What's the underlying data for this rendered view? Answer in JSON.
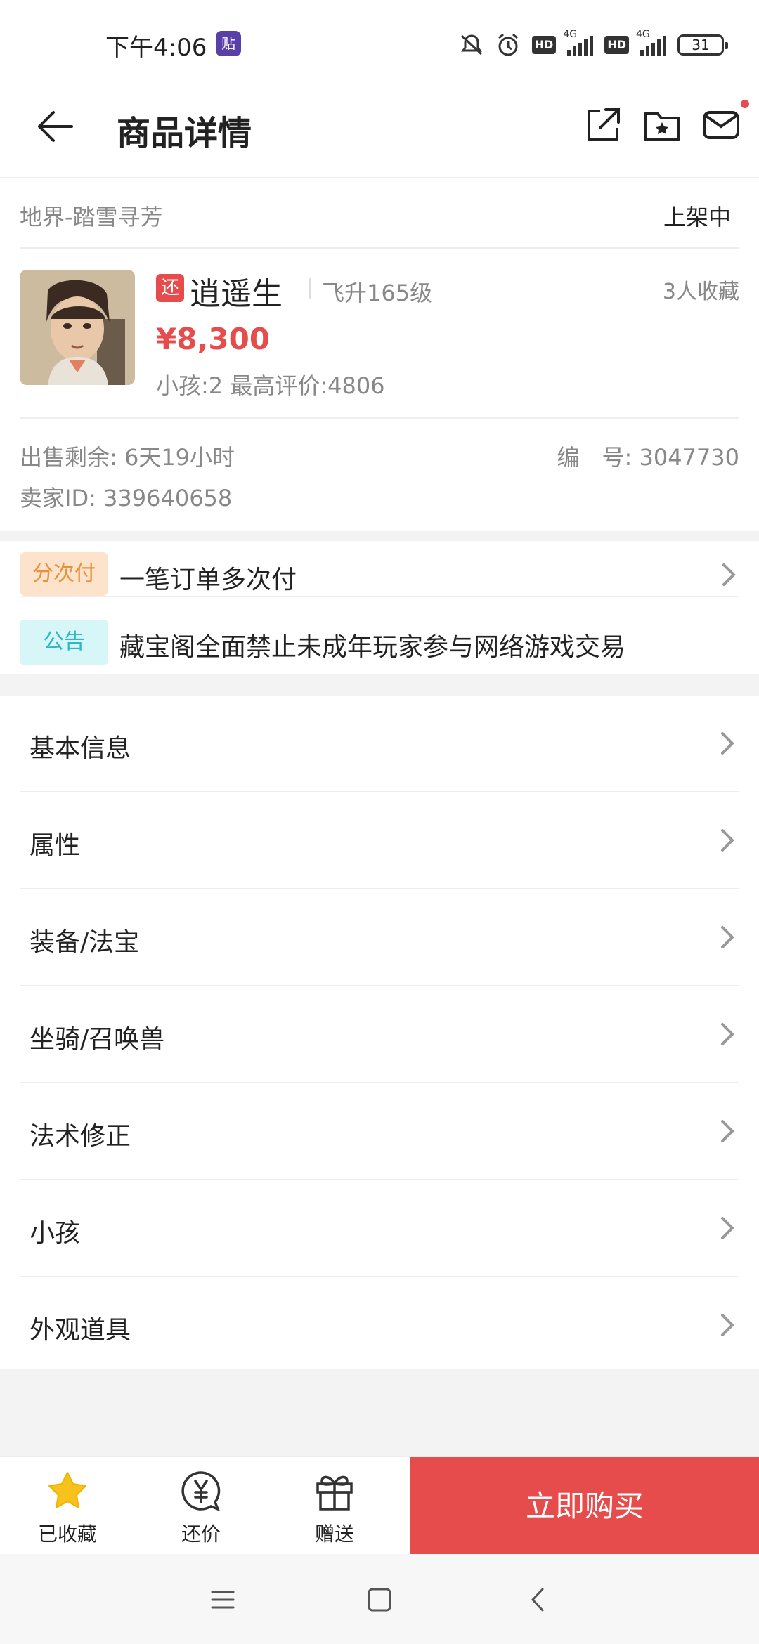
{
  "status_bar": {
    "time": "下午4:06",
    "app_badge": "贴",
    "battery": "31",
    "signal_1_label": "4G",
    "signal_2_label": "4G",
    "hd_1": "HD",
    "hd_2": "HD"
  },
  "header": {
    "title": "商品详情"
  },
  "server": {
    "name": "地界-踏雪寻芳",
    "status": "上架中"
  },
  "product": {
    "badge": "还",
    "name": "逍遥生",
    "level": "飞升165级",
    "favorites": "3人收藏",
    "price": "¥8,300",
    "kids_eval": "小孩:2 最高评价:4806"
  },
  "meta": {
    "sell_time": "出售剩余: 6天19小时",
    "serial": "编　号: 3047730",
    "seller": "卖家ID: 339640658"
  },
  "promo": {
    "installment_tag": "分次付",
    "installment_text": "一笔订单多次付",
    "notice_tag": "公告",
    "notice_text": "藏宝阁全面禁止未成年玩家参与网络游戏交易"
  },
  "menu": {
    "items": [
      {
        "label": "基本信息"
      },
      {
        "label": "属性"
      },
      {
        "label": "装备/法宝"
      },
      {
        "label": "坐骑/召唤兽"
      },
      {
        "label": "法术修正"
      },
      {
        "label": "小孩"
      },
      {
        "label": "外观道具"
      }
    ]
  },
  "bottom_bar": {
    "favorited_label": "已收藏",
    "bargain_label": "还价",
    "gift_label": "赠送",
    "buy_label": "立即购买"
  },
  "colors": {
    "accent": "#e74c4c",
    "star": "#f7c21c",
    "installment_bg": "#fde3cc",
    "notice_bg": "#d6f6f8"
  }
}
